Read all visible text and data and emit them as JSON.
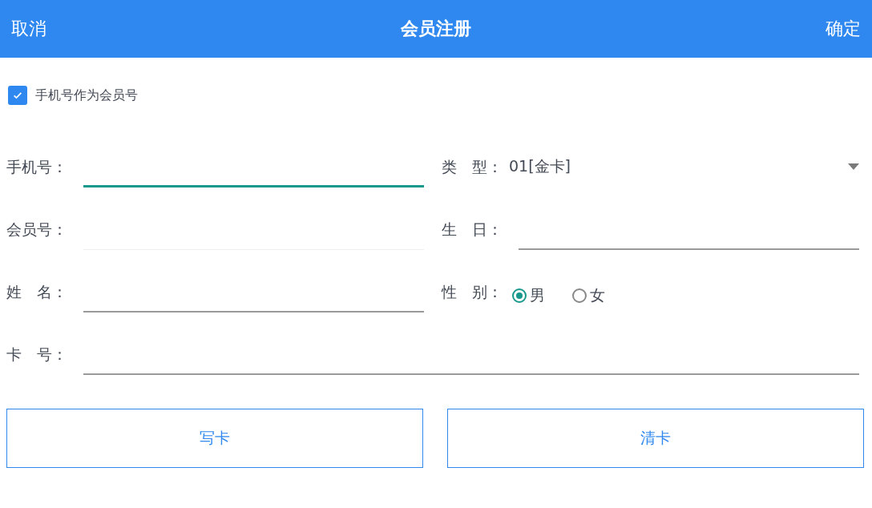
{
  "header": {
    "cancel": "取消",
    "title": "会员注册",
    "confirm": "确定"
  },
  "option": {
    "label": "手机号作为会员号",
    "checked": true
  },
  "rows": [
    {
      "fields": [
        {
          "kind": "text",
          "label": "手机号：",
          "focused": true,
          "disabled": false
        },
        {
          "kind": "select",
          "label": "类　型：",
          "value": "01[金卡]"
        }
      ]
    },
    {
      "fields": [
        {
          "kind": "text",
          "label": "会员号：",
          "focused": false,
          "disabled": true
        },
        {
          "kind": "text",
          "label": "生　日：",
          "focused": false,
          "disabled": false
        }
      ]
    },
    {
      "fields": [
        {
          "kind": "text",
          "label": "姓　名：",
          "focused": false,
          "disabled": false
        },
        {
          "kind": "radio",
          "label": "性　别：",
          "options": [
            {
              "label": "男",
              "selected": true
            },
            {
              "label": "女",
              "selected": false
            }
          ]
        }
      ]
    },
    {
      "fields": [
        {
          "kind": "text",
          "label": "卡　号：",
          "focused": false,
          "disabled": false
        }
      ]
    }
  ],
  "buttons": [
    "写卡",
    "清卡"
  ]
}
